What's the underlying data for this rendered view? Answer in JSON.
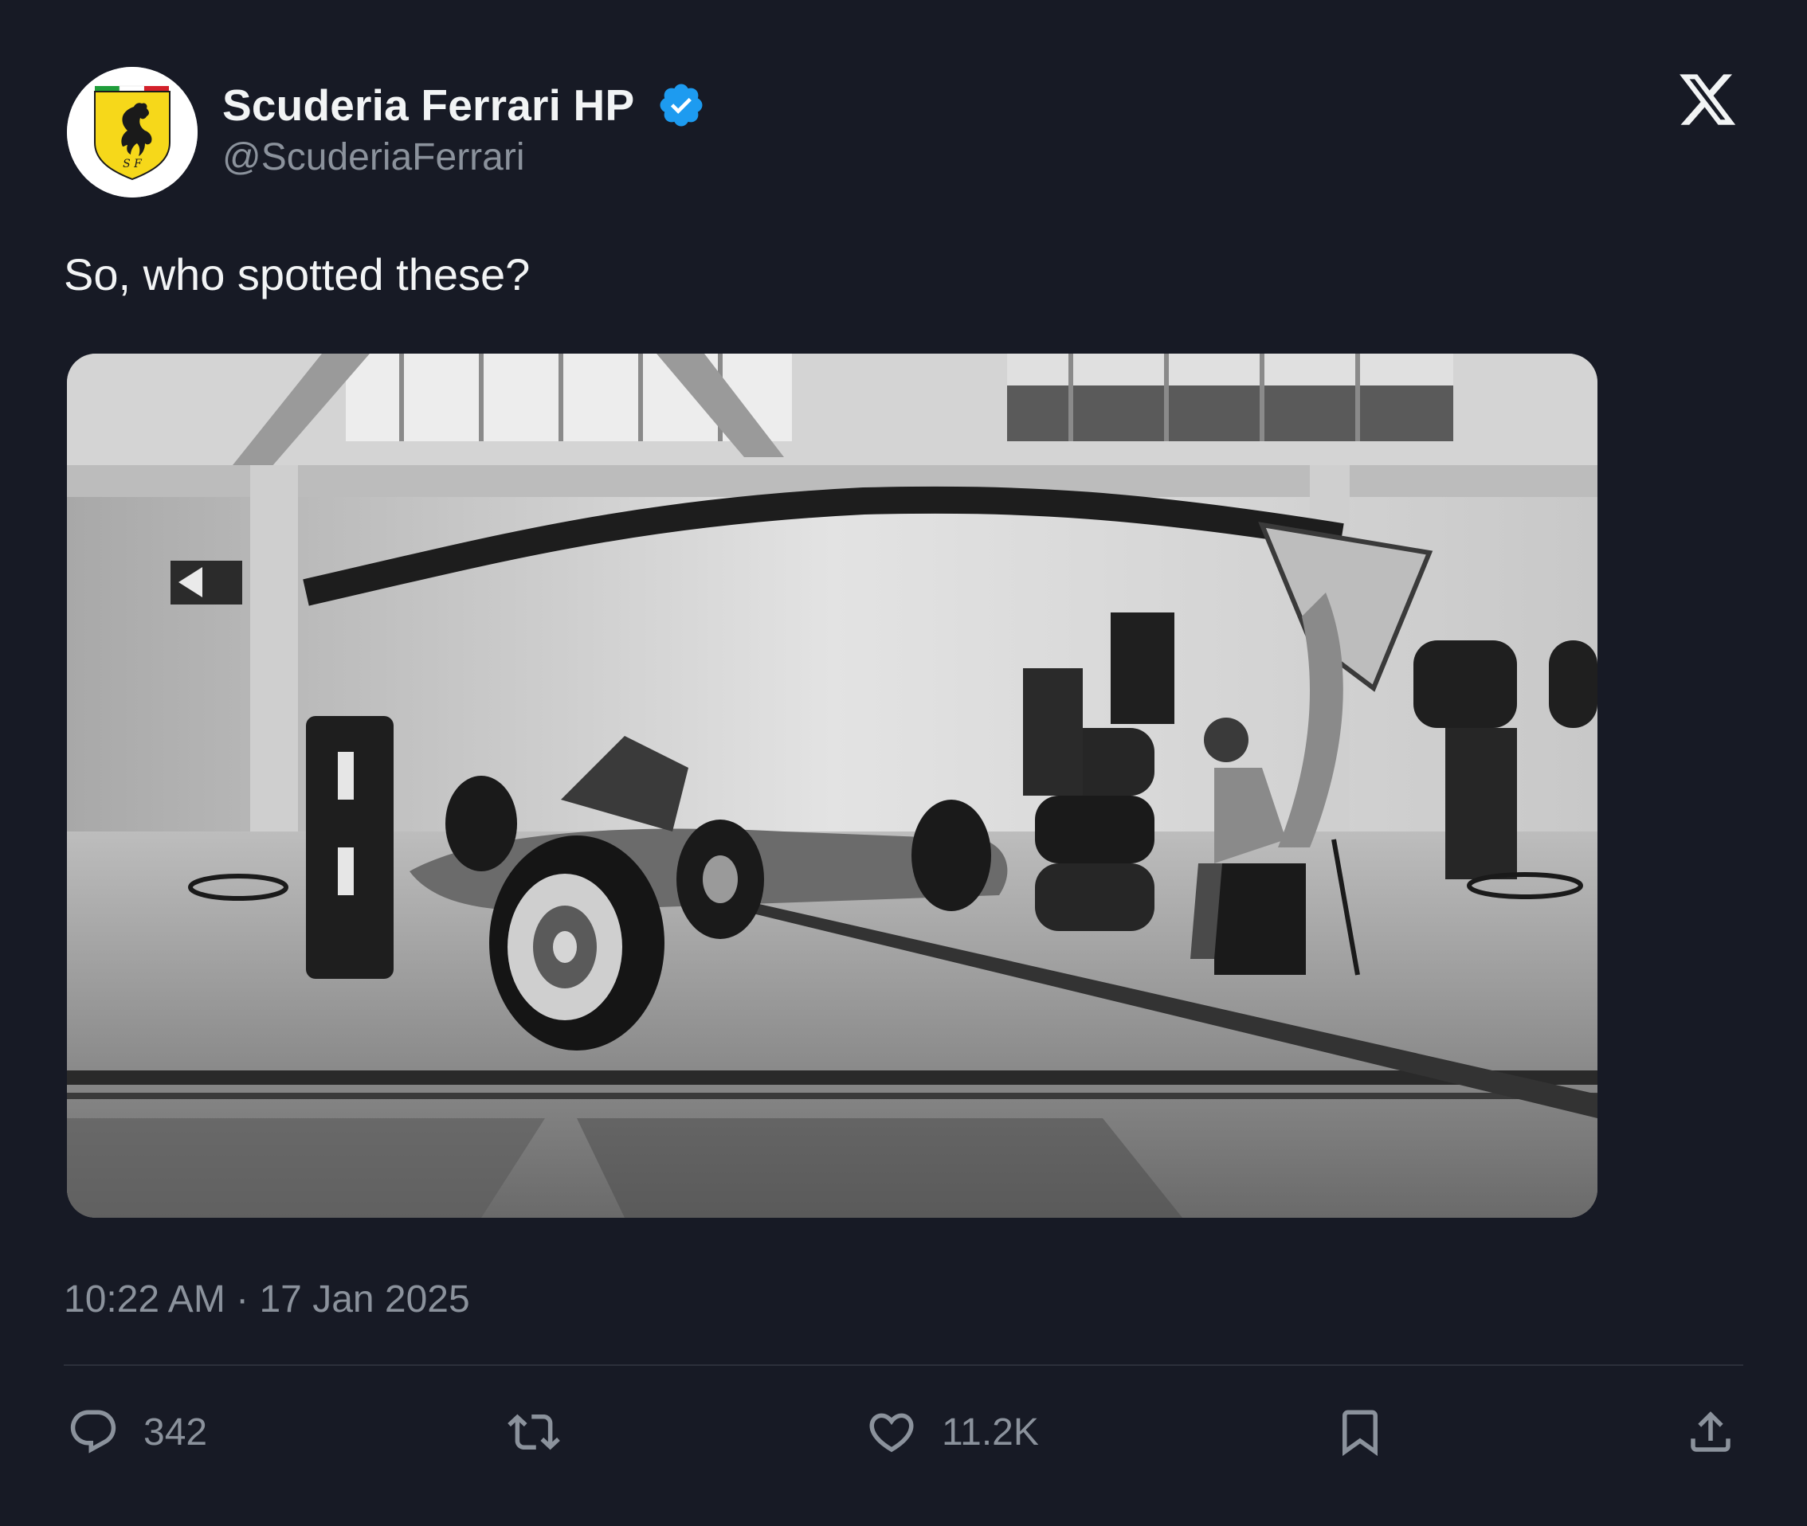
{
  "author": {
    "display_name": "Scuderia Ferrari HP",
    "handle": "@ScuderiaFerrari",
    "verified": true,
    "avatar_icon": "ferrari-shield-logo-icon",
    "logo_text": "S F"
  },
  "platform": {
    "icon": "x-logo-icon"
  },
  "tweet": {
    "text": "So, who spotted these?",
    "timestamp": "10:22 AM · 17 Jan 2025",
    "media": {
      "kind": "photo",
      "icon": "photo-black-and-white-garage"
    }
  },
  "actions": {
    "reply": {
      "icon": "reply-bubble-icon",
      "count": "342"
    },
    "retweet": {
      "icon": "retweet-icon",
      "count": ""
    },
    "like": {
      "icon": "heart-icon",
      "count": "11.2K"
    },
    "bookmark": {
      "icon": "bookmark-icon"
    },
    "share": {
      "icon": "share-upload-icon"
    }
  },
  "colors": {
    "background": "#171a25",
    "text_primary": "#f2f4f5",
    "text_secondary": "#8b929c",
    "verified_blue": "#1d9bf0",
    "divider": "#2c303b",
    "ferrari_yellow": "#f6d81a"
  }
}
